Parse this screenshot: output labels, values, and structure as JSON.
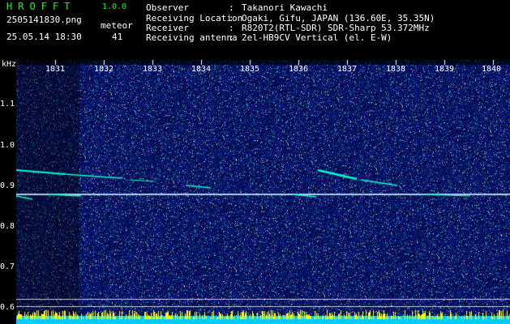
{
  "app": {
    "title": "HROFFT",
    "version": "1.0.0"
  },
  "file": {
    "name": "2505141830.png",
    "timestamp": "25.05.14 18:30"
  },
  "meteor": {
    "label": "meteor",
    "count": "41"
  },
  "info": [
    {
      "label": "Observer",
      "value": "Takanori Kawachi"
    },
    {
      "label": "Receiving Location",
      "value": "Ogaki, Gifu, JAPAN (136.60E, 35.35N)"
    },
    {
      "label": "Receiver",
      "value": "R820T2(RTL-SDR) SDR-Sharp 53.372MHz"
    },
    {
      "label": "Receiving antenna",
      "value": "2el-HB9CV Vertical (el. E-W)"
    }
  ],
  "axis": {
    "unit": "kHz",
    "y_ticks": [
      "1.1",
      "1.0",
      "0.9",
      "0.8",
      "0.7",
      "0.6"
    ],
    "x_ticks": [
      "1831",
      "1832",
      "1833",
      "1834",
      "1835",
      "1836",
      "1837",
      "1838",
      "1839",
      "1840"
    ]
  },
  "colors": {
    "background": "#000000",
    "header_accent": "#00ff00",
    "noise_base": "#1a1aa8",
    "trace": "#00ffcc",
    "carrier": "#c8f0ff",
    "level_bar": "#00ccff",
    "level_peak": "#ffff00"
  }
}
